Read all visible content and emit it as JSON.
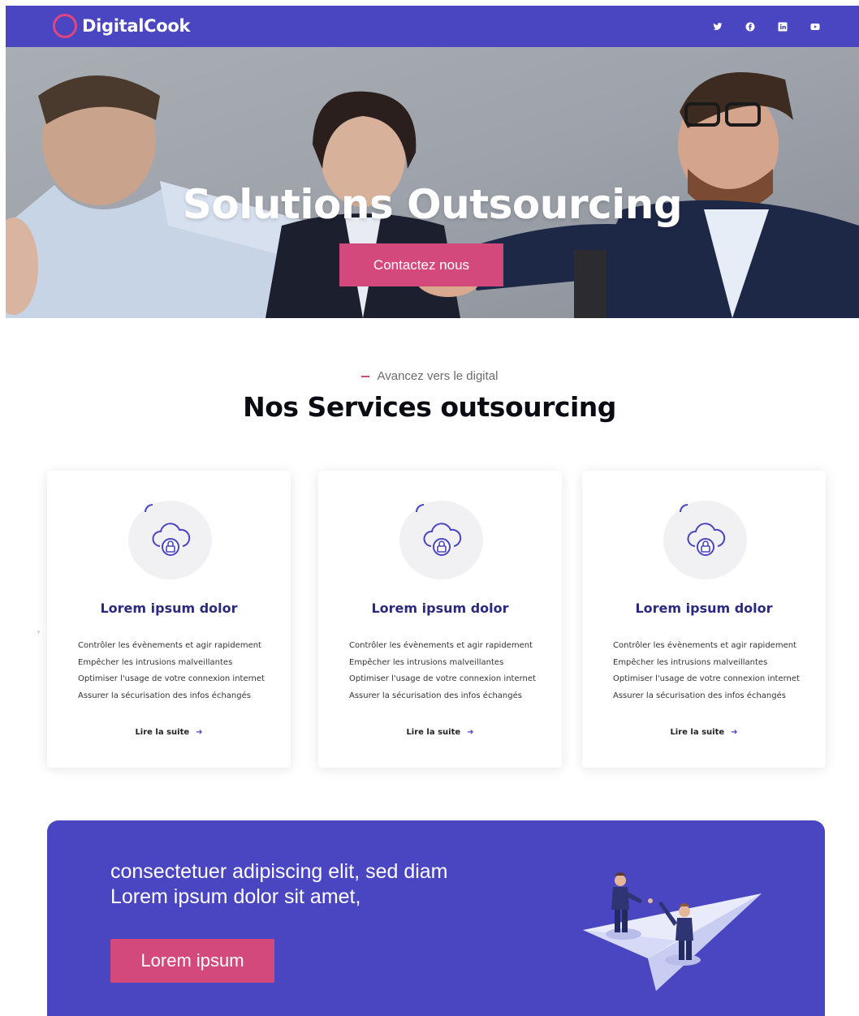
{
  "brand": {
    "name": "DigitalCook",
    "color": "#4a45c0",
    "accent": "#d4497b"
  },
  "header": {
    "socials": [
      {
        "icon": "twitter-icon"
      },
      {
        "icon": "facebook-icon"
      },
      {
        "icon": "linkedin-icon"
      },
      {
        "icon": "youtube-icon"
      }
    ]
  },
  "hero": {
    "title": "Solutions Outsourcing",
    "button_label": "Contactez nous"
  },
  "services": {
    "eyebrow": "Avancez vers le digital",
    "title": "Nos Services outsourcing",
    "cards": [
      {
        "icon": "cloud-lock-icon",
        "title": "Lorem ipsum dolor",
        "items": [
          "Contrôler les évènements et agir rapidement",
          "Empêcher les intrusions malveillantes",
          "Optimiser l'usage de votre connexion internet",
          "Assurer la sécurisation des infos échangés"
        ],
        "link": "Lire la suite"
      },
      {
        "icon": "cloud-lock-icon",
        "title": "Lorem ipsum dolor",
        "items": [
          "Contrôler les évènements et agir rapidement",
          "Empêcher les intrusions malveillantes",
          "Optimiser l'usage de votre connexion internet",
          "Assurer la sécurisation des infos échangés"
        ],
        "link": "Lire la suite"
      },
      {
        "icon": "cloud-lock-icon",
        "title": "Lorem ipsum dolor",
        "items": [
          "Contrôler les évènements et agir rapidement",
          "Empêcher les intrusions malveillantes",
          "Optimiser l'usage de votre connexion internet",
          "Assurer la sécurisation des infos échangés"
        ],
        "link": "Lire la suite"
      }
    ]
  },
  "cta": {
    "line1": "consectetuer adipiscing elit, sed diam",
    "line2": "Lorem ipsum dolor sit amet,",
    "button_label": "Lorem ipsum"
  }
}
